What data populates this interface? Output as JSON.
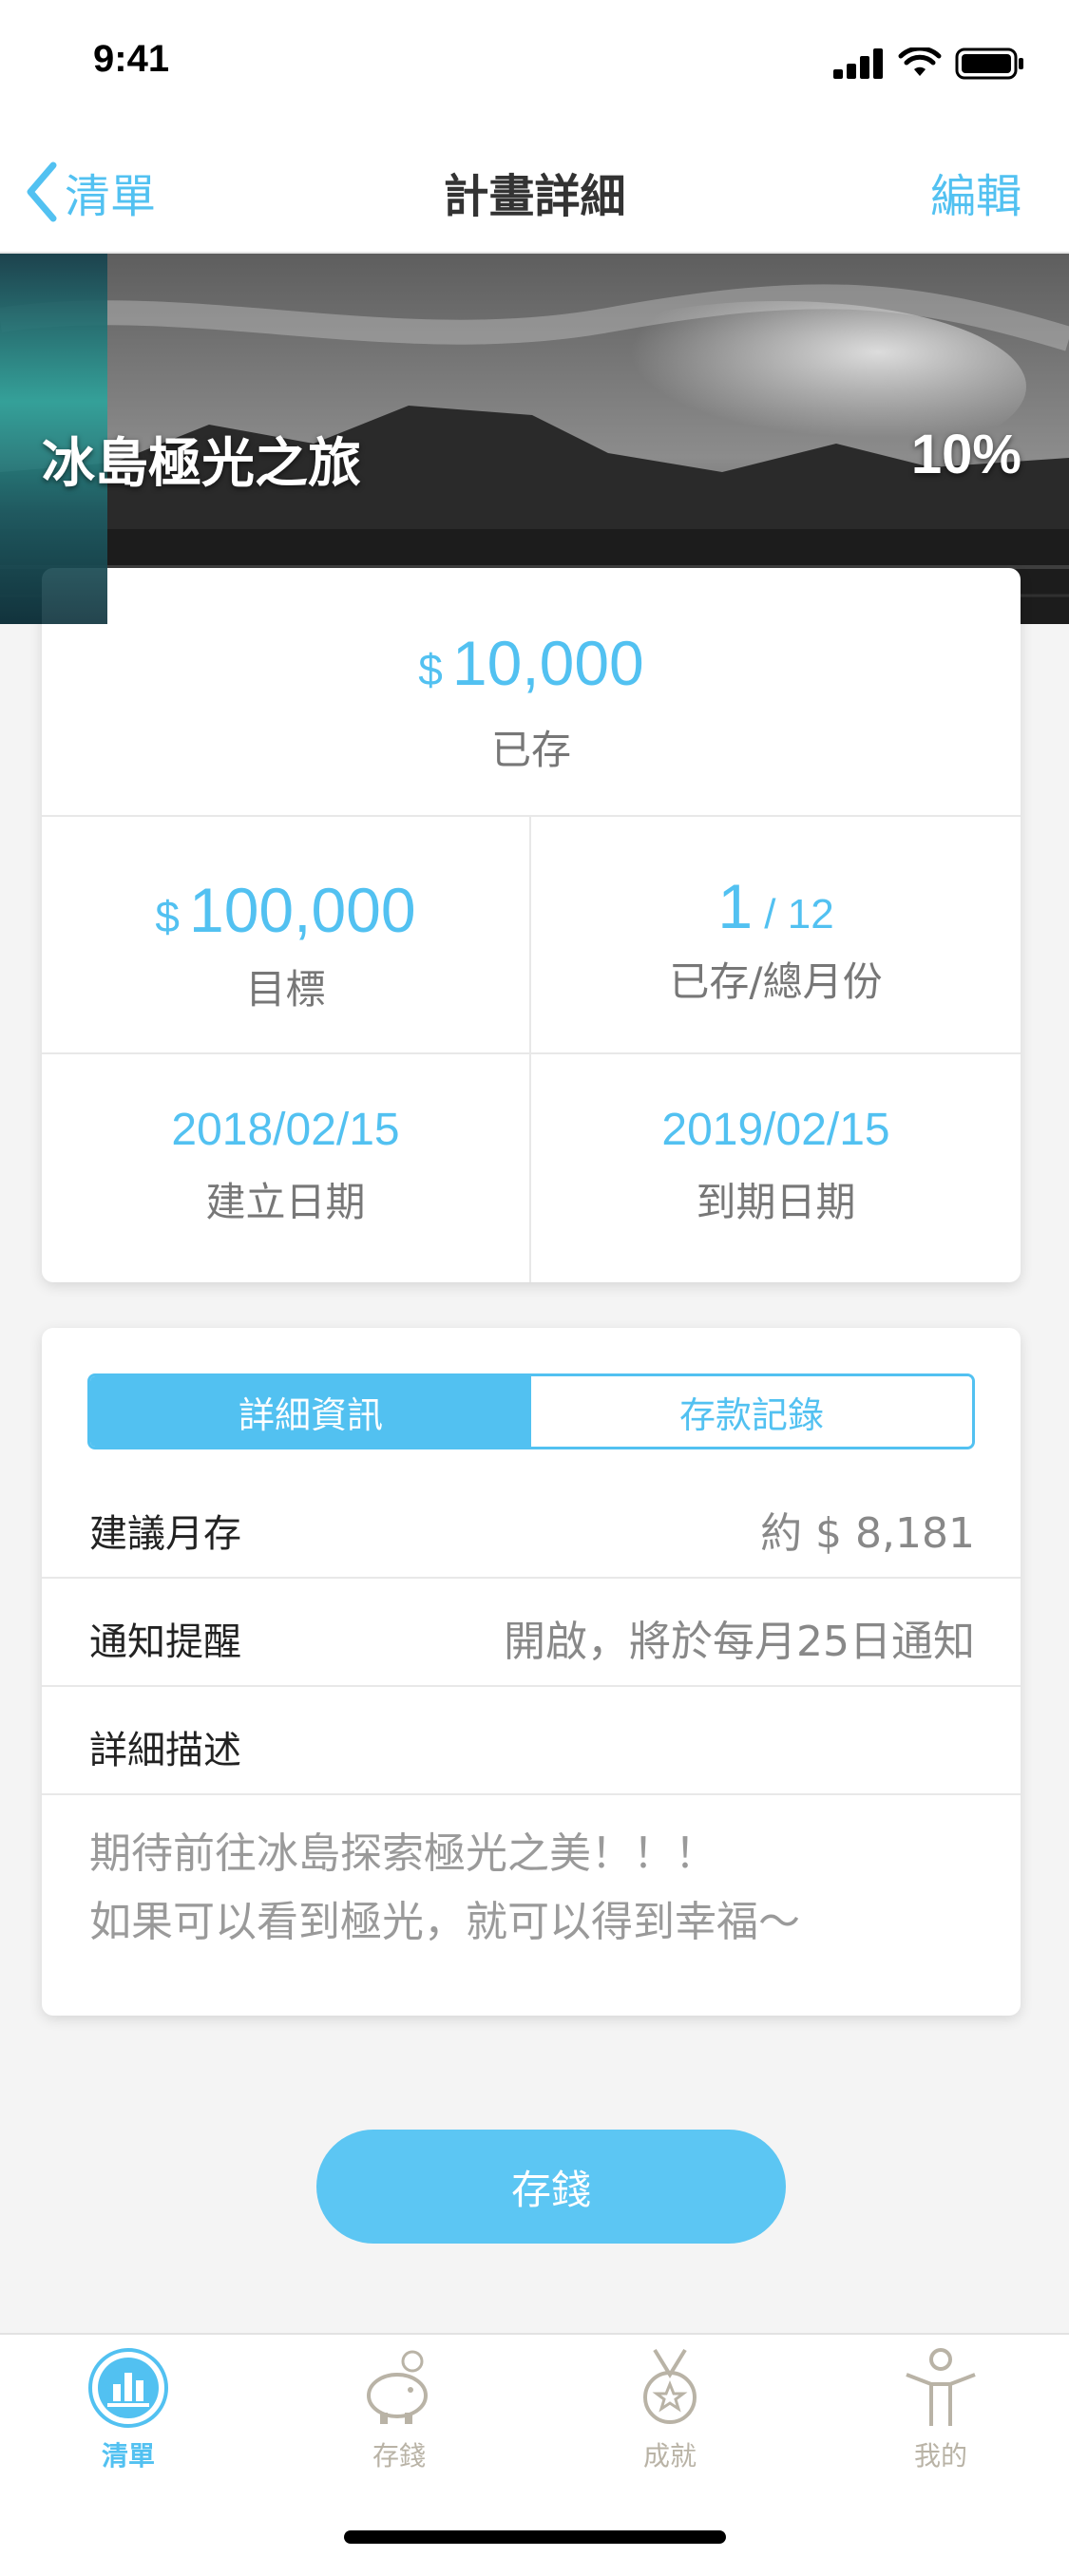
{
  "status_bar": {
    "time": "9:41"
  },
  "nav": {
    "back_label": "清單",
    "title": "計畫詳細",
    "edit_label": "編輯"
  },
  "hero": {
    "title": "冰島極光之旅",
    "percent": "10%",
    "progress": 0.1
  },
  "summary": {
    "saved": {
      "currency": "$",
      "amount": "10,000",
      "label": "已存"
    },
    "target": {
      "currency": "$",
      "amount": "100,000",
      "label": "目標"
    },
    "months": {
      "saved": "1",
      "separator": " / ",
      "total": "12",
      "label": "已存/總月份"
    },
    "created": {
      "date": "2018/02/15",
      "label": "建立日期"
    },
    "due": {
      "date": "2019/02/15",
      "label": "到期日期"
    }
  },
  "details": {
    "tabs": [
      {
        "label": "詳細資訊",
        "active": true
      },
      {
        "label": "存款記錄",
        "active": false
      }
    ],
    "rows": [
      {
        "label": "建議月存",
        "value": "約 $ 8,181"
      },
      {
        "label": "通知提醒",
        "value": "開啟，將於每月25日通知"
      },
      {
        "label": "詳細描述",
        "value": ""
      }
    ],
    "description": [
      "期待前往冰島探索極光之美！！！",
      "如果可以看到極光，就可以得到幸福～"
    ]
  },
  "save_button": {
    "label": "存錢"
  },
  "tab_bar": {
    "items": [
      {
        "label": "清單",
        "icon": "list-chart-icon",
        "active": true
      },
      {
        "label": "存錢",
        "icon": "piggy-bank-icon",
        "active": false
      },
      {
        "label": "成就",
        "icon": "medal-icon",
        "active": false
      },
      {
        "label": "我的",
        "icon": "person-icon",
        "active": false
      }
    ]
  },
  "colors": {
    "accent": "#52c1f1",
    "muted": "#b9b3a6",
    "hero_progress": "#2ea39b"
  }
}
